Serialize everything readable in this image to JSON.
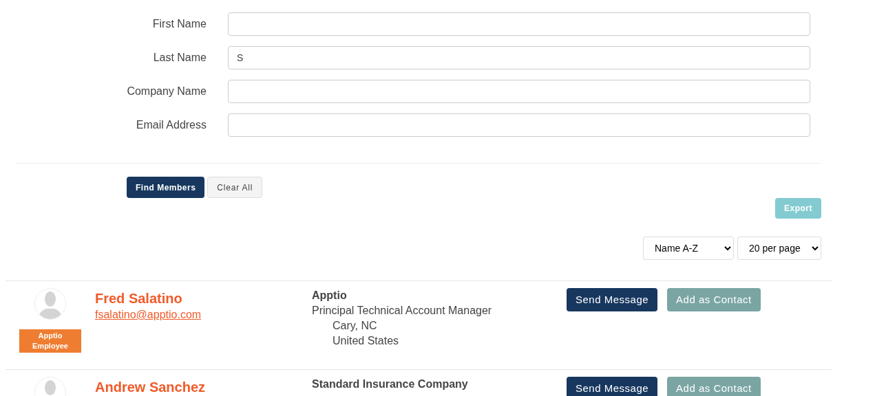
{
  "search_form": {
    "fields": [
      {
        "label": "First Name"
      },
      {
        "label": "Last Name",
        "value": "S"
      },
      {
        "label": "Company Name"
      },
      {
        "label": "Email Address"
      }
    ],
    "buttons": {
      "find": "Find Members",
      "clear": "Clear All"
    }
  },
  "export_button": "Export",
  "sort_select": "Name A-Z",
  "page_size_select": "20 per page",
  "members": [
    {
      "name": "Fred Salatino",
      "email": "fsalatino@apptio.com",
      "badge": "Apptio Employee",
      "company": "Apptio",
      "title": "Principal Technical Account Manager",
      "location": [
        "Cary, NC",
        "United States"
      ],
      "actions": [
        "Send Message",
        "Add as Contact"
      ]
    },
    {
      "name": "Andrew Sanchez",
      "company": "Standard Insurance Company",
      "actions": [
        "Send Message",
        "Add as Contact"
      ]
    }
  ]
}
